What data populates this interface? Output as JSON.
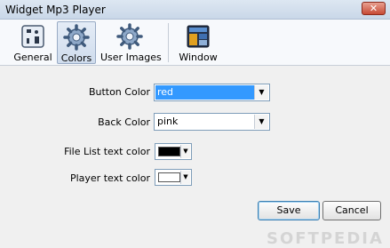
{
  "window": {
    "title": "Widget Mp3 Player",
    "close_glyph": "✕"
  },
  "toolbar": {
    "items": [
      {
        "label": "General",
        "icon": "general-settings-icon"
      },
      {
        "label": "Colors",
        "icon": "gear-icon",
        "active": true
      },
      {
        "label": "User Images",
        "icon": "gear-icon"
      },
      {
        "label": "Window",
        "icon": "window-icon"
      }
    ]
  },
  "form": {
    "button_color": {
      "label": "Button Color",
      "value": "red"
    },
    "back_color": {
      "label": "Back Color",
      "value": "pink"
    },
    "file_list_text_color": {
      "label": "File List text color",
      "color": "#000000"
    },
    "player_text_color": {
      "label": "Player text color",
      "color": "#ffffff"
    }
  },
  "buttons": {
    "save": "Save",
    "cancel": "Cancel"
  },
  "colors": {
    "selection": "#3399ff",
    "accent_border": "#7f9db9"
  }
}
